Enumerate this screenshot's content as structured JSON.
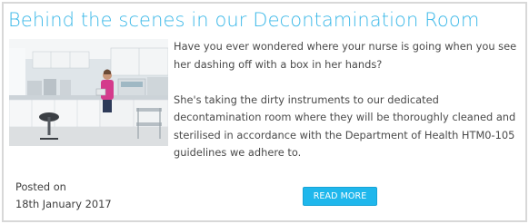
{
  "article": {
    "title": "Behind the scenes in our Decontamination Room",
    "image_alt": "Nurse in decontamination room",
    "paragraphs": [
      "Have you ever wondered where your nurse is going when you see her dashing off with a box in her hands?",
      "She's taking the dirty instruments to our dedicated decontamination room where they will be thoroughly cleaned and sterilised in accordance with the Department of Health HTM0-105 guidelines we adhere to."
    ],
    "posted_label": "Posted on",
    "posted_date": "18th January 2017",
    "read_more_label": "READ MORE"
  },
  "colors": {
    "title": "#3bb8e8",
    "button": "#1fb7ec",
    "border": "#d8d8d8",
    "text": "#4a4a4a"
  }
}
